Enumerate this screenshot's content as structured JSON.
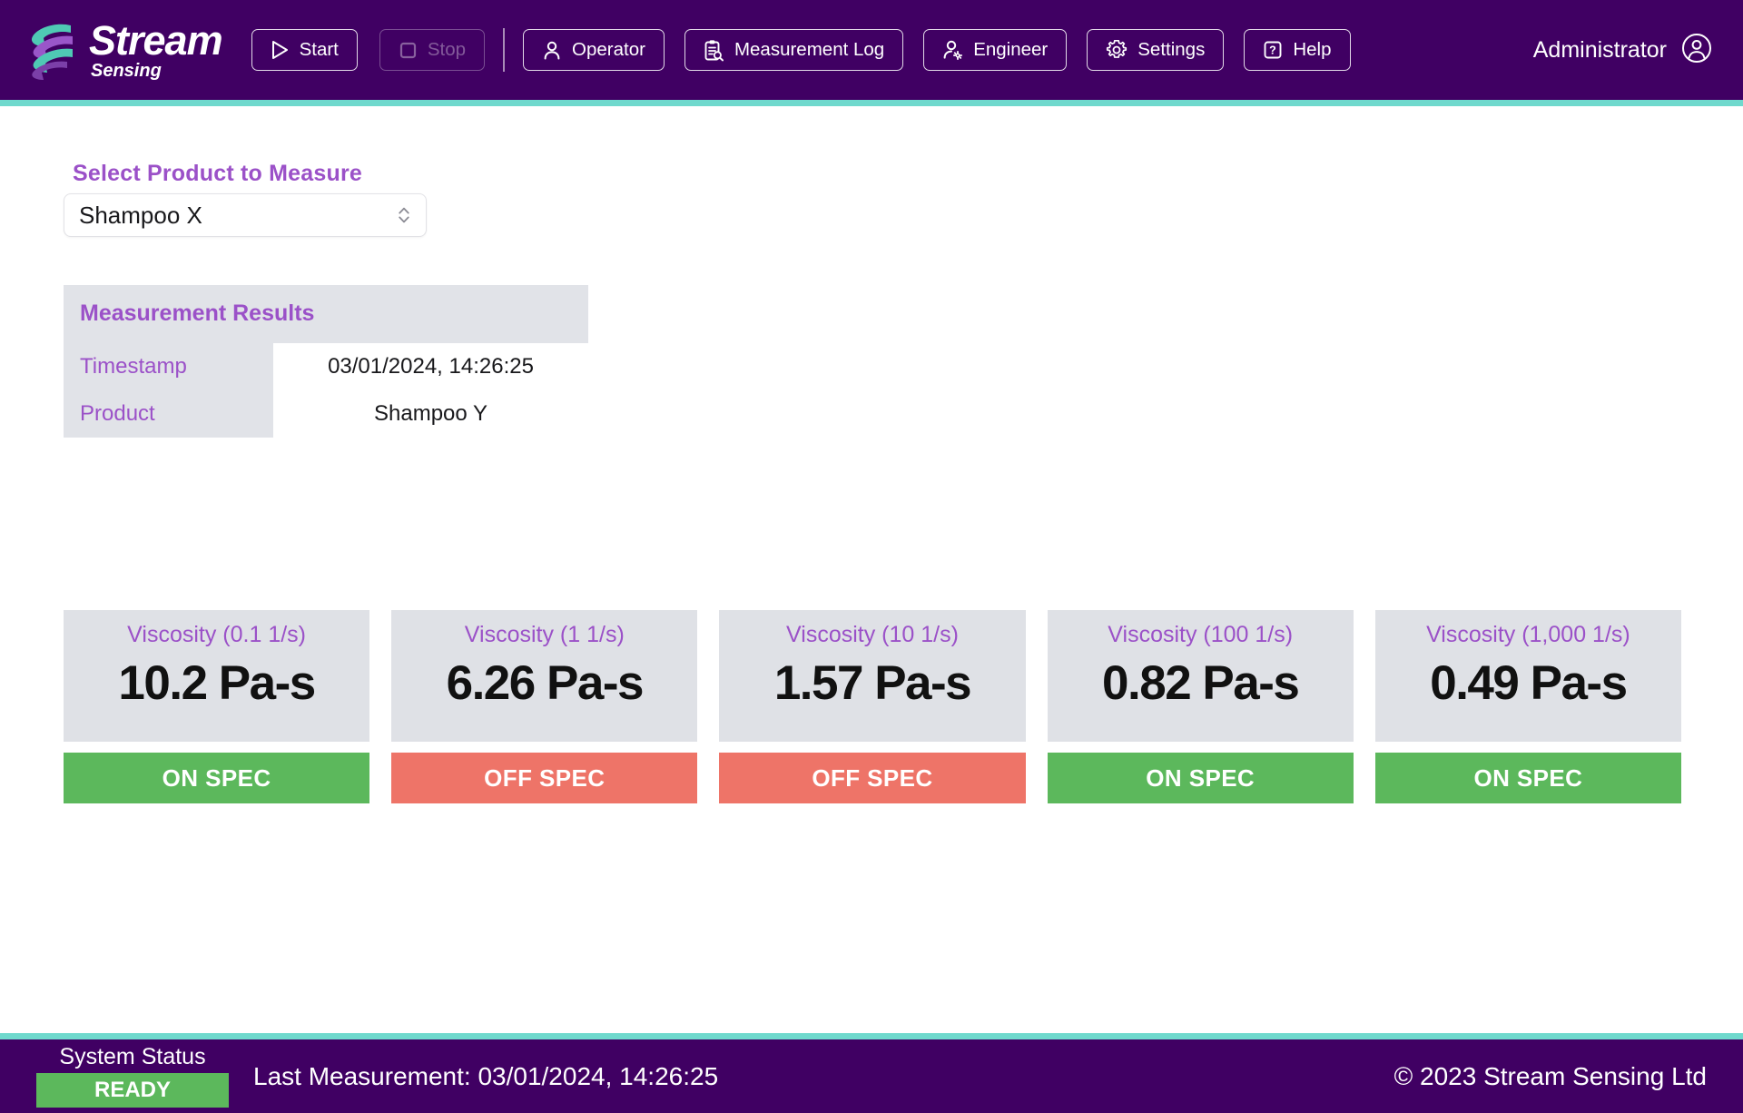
{
  "header": {
    "logo": {
      "brand": "Stream",
      "tagline": "Sensing"
    },
    "buttons": [
      {
        "key": "start",
        "label": "Start",
        "icon": "play-icon",
        "disabled": false
      },
      {
        "key": "stop",
        "label": "Stop",
        "icon": "square-stop-icon",
        "disabled": true
      },
      {
        "key": "operator",
        "label": "Operator",
        "icon": "user-icon"
      },
      {
        "key": "measurement-log",
        "label": "Measurement Log",
        "icon": "clipboard-search-icon"
      },
      {
        "key": "engineer",
        "label": "Engineer",
        "icon": "user-gear-icon"
      },
      {
        "key": "settings",
        "label": "Settings",
        "icon": "gear-icon"
      },
      {
        "key": "help",
        "label": "Help",
        "icon": "question-box-icon"
      }
    ],
    "user": {
      "name": "Administrator",
      "icon": "account-circle-icon"
    }
  },
  "main": {
    "select_label": "Select Product to Measure",
    "product_select": {
      "value": "Shampoo X",
      "icon": "chevron-updown-icon"
    },
    "results": {
      "title": "Measurement Results",
      "rows": [
        {
          "key": "Timestamp",
          "value": "03/01/2024, 14:26:25"
        },
        {
          "key": "Product",
          "value": "Shampoo Y"
        }
      ]
    },
    "cards": [
      {
        "label": "Viscosity (0.1 1/s)",
        "value": "10.2 Pa-s",
        "status": "ON SPEC",
        "state": "on"
      },
      {
        "label": "Viscosity (1 1/s)",
        "value": "6.26 Pa-s",
        "status": "OFF SPEC",
        "state": "off"
      },
      {
        "label": "Viscosity (10 1/s)",
        "value": "1.57 Pa-s",
        "status": "OFF SPEC",
        "state": "off"
      },
      {
        "label": "Viscosity (100 1/s)",
        "value": "0.82 Pa-s",
        "status": "ON SPEC",
        "state": "on"
      },
      {
        "label": "Viscosity (1,000 1/s)",
        "value": "0.49 Pa-s",
        "status": "ON SPEC",
        "state": "on"
      }
    ]
  },
  "footer": {
    "system_status_label": "System Status",
    "system_status_value": "READY",
    "last_measurement": "Last Measurement: 03/01/2024, 14:26:25",
    "copyright": "© 2023 Stream Sensing Ltd"
  },
  "colors": {
    "brand_purple": "#400063",
    "accent_teal": "#6fd9cd",
    "label_purple": "#9b51c8",
    "on_spec_green": "#5cb85c",
    "off_spec_red": "#ee7468",
    "card_grey": "#dfe1e6"
  }
}
